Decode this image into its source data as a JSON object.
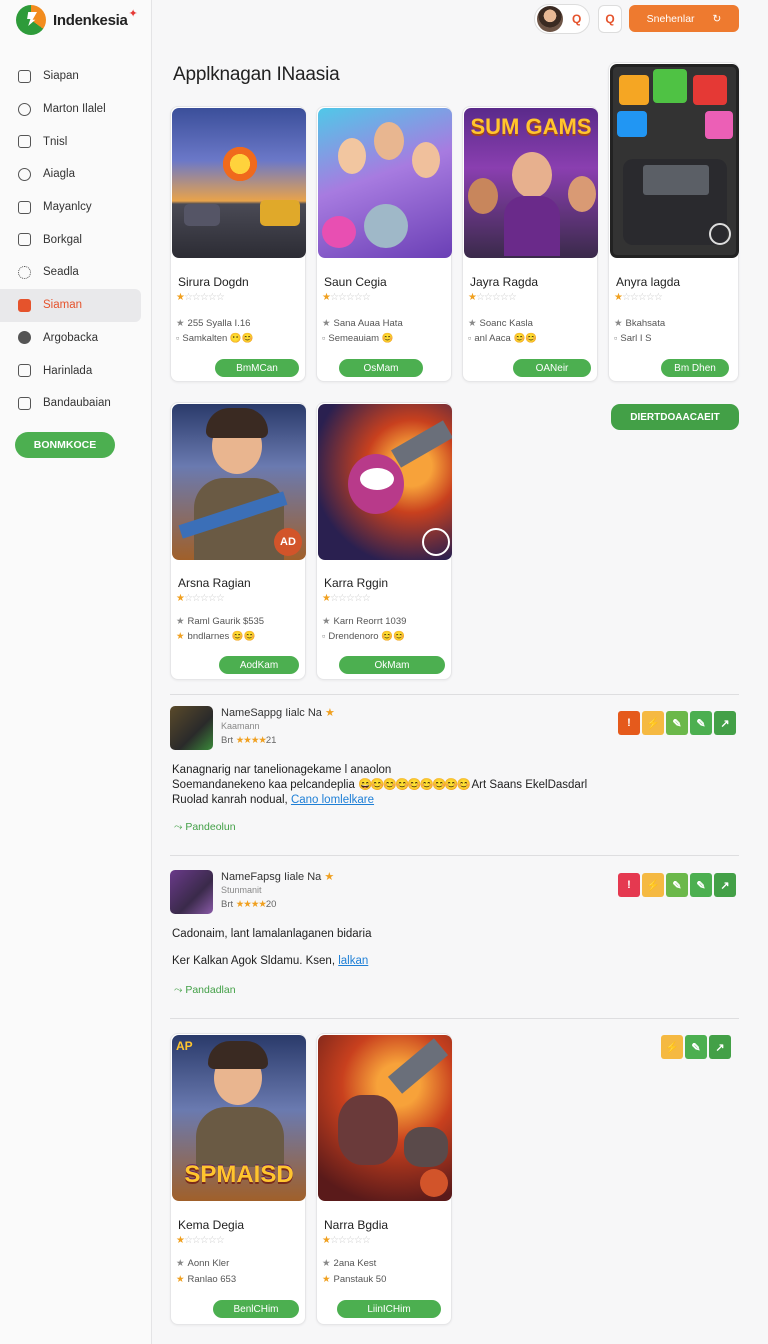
{
  "brand": {
    "name": "Indenkesia",
    "accent": "#e5532c",
    "green": "#4caf50"
  },
  "sidebar": {
    "items": [
      {
        "label": "Siapan",
        "icon": "person-icon"
      },
      {
        "label": "Marton Ilalel",
        "icon": "search-icon"
      },
      {
        "label": "Tnisl",
        "icon": "doc-icon"
      },
      {
        "label": "Aiagla",
        "icon": "circle-icon"
      },
      {
        "label": "Mayanlcy",
        "icon": "back-icon"
      },
      {
        "label": "Borkgal",
        "icon": "box-icon"
      },
      {
        "label": "Seadla",
        "icon": "gear-icon"
      },
      {
        "label": "Siaman",
        "icon": "home-icon"
      },
      {
        "label": "Argobacka",
        "icon": "target-icon"
      },
      {
        "label": "Harinlada",
        "icon": "list-icon"
      },
      {
        "label": "Bandaubaian",
        "icon": "calendar-icon"
      }
    ],
    "button_label": "BONMKOCE"
  },
  "topbar": {
    "avatar_icon": "Q",
    "square_icon": "Q",
    "button_label": "Snehenlar",
    "button_icon": "refresh-icon"
  },
  "page_title": "Applknagan INaasia",
  "row1": [
    {
      "name": "Sirura Dogdn",
      "stars": "★☆☆☆☆☆",
      "meta1": "255 Syalla I.16",
      "meta2": "Samkalten 😶😊",
      "button": "BmMCan"
    },
    {
      "name": "Saun Cegia",
      "stars": "★☆☆☆☆☆",
      "meta1": "Sana Auaa Hata",
      "meta2": "Semeauiam 😊",
      "button": "OsMam"
    },
    {
      "name": "Jayra Ragda",
      "stars": "★☆☆☆☆☆",
      "meta1": "Soanc Kasla",
      "meta2": "anl Aaca 😊😊",
      "button": "OANeir"
    },
    {
      "name": "Anyra lagda",
      "stars": "★☆☆☆☆☆",
      "meta1": "Bkahsata",
      "meta2": "Sarl I S",
      "button": "Bm Dhen"
    }
  ],
  "banner_game_title": "SUM GAMS",
  "download_button": "DIERTDOAACAEIT",
  "row2": [
    {
      "name": "Arsna Ragian",
      "stars": "★☆☆☆☆☆",
      "meta1": "Raml Gaurik $535",
      "meta2": "bndlarnes 😊😊",
      "button": "AodKam",
      "badge": "AD"
    },
    {
      "name": "Karra Rggin",
      "stars": "★☆☆☆☆☆",
      "meta1": "Karn Reorrt 1039",
      "meta2": "Drendenoro 😊😊",
      "button": "OkMam"
    }
  ],
  "reviews": [
    {
      "name": "NameSappg Iialc Na",
      "sub": "Kaamann",
      "meta": "Brt",
      "rating_stars": "★★★★",
      "rating_count": "21",
      "line1": "Kanagnarig nar tanelionagekame l anaolon",
      "line2a": "Soemandanekeno kaa pelcandeplia",
      "line2coins": "😄😊😊😊😊😊😊😊😊",
      "line2b": "Art Saans EkelDasdarl",
      "line3a": "Ruolad kanrah nodual,",
      "line3link": "Cano lomlelkare",
      "reply": "Pandeolun"
    },
    {
      "name": "NameFapsg Iiale Na",
      "sub": "Stunmanit",
      "meta": "Brt",
      "rating_stars": "★★★★",
      "rating_count": "20",
      "line1": "Cadonaim, lant lamalanlaganen bidaria",
      "line2a": "Ker Kalkan Agok Sldamu. Ksen,",
      "line2link": "lalkan",
      "reply": "Pandadlan"
    }
  ],
  "row3": [
    {
      "name": "Kema Degia",
      "stars": "★☆☆☆☆☆",
      "meta1": "Aonn Kler",
      "meta2": "Ranlao 653",
      "button": "BenlCHim",
      "badge": "AP",
      "title": "SPMAISD"
    },
    {
      "name": "Narra Bgdia",
      "stars": "★☆☆☆☆☆",
      "meta1": "2ana Kest",
      "meta2": "Panstauk 50",
      "button": "LiinICHim"
    }
  ]
}
